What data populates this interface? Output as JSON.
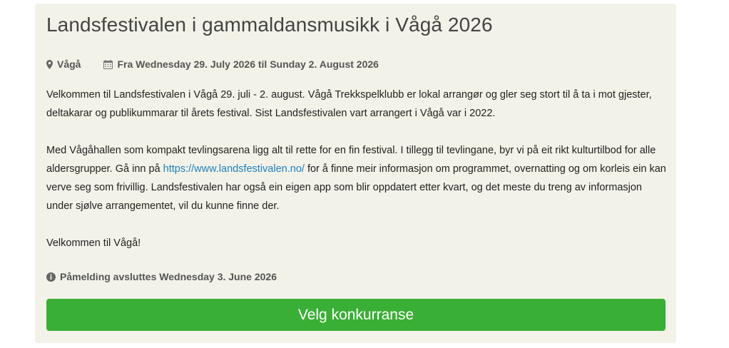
{
  "event": {
    "title": "Landsfestivalen i gammaldansmusikk i Vågå 2026",
    "location": "Vågå",
    "dates": "Fra Wednesday 29. July 2026 til Sunday 2. August 2026",
    "paragraphs": {
      "p1": "Velkommen til Landsfestivalen i Vågå 29. juli - 2. august. Vågå Trekkspelklubb er lokal arrangør og gler seg stort til å ta i mot gjester, deltakarar og publikummarar til årets festival. Sist Landsfestivalen vart arrangert i Vågå var i 2022.",
      "p2_before": "Med Vågåhallen som kompakt tevlingsarena ligg alt til rette for en fin festival. I tillegg til tevlingane, byr vi på eit rikt kulturtilbod for alle aldersgrupper. Gå inn på ",
      "p2_link": "https://www.landsfestivalen.no/",
      "p2_after": " for å finne meir informasjon om programmet, overnatting og om korleis ein kan verve seg som frivillig. Landsfestivalen har også ein eigen app som blir oppdatert etter kvart, og det meste du treng av informasjon under sjølve arrangementet, vil du kunne finne der.",
      "p3": "Velkommen til Vågå!"
    },
    "deadline": "Påmelding avsluttes Wednesday 3. June 2026",
    "button_label": "Velg konkurranse",
    "icons": {
      "location": "map-marker-icon",
      "calendar": "calendar-icon",
      "info": "info-circle-icon"
    },
    "colors": {
      "card_bg": "#f2f2e8",
      "button": "#3aaf35",
      "link": "#1f7fc0"
    }
  }
}
